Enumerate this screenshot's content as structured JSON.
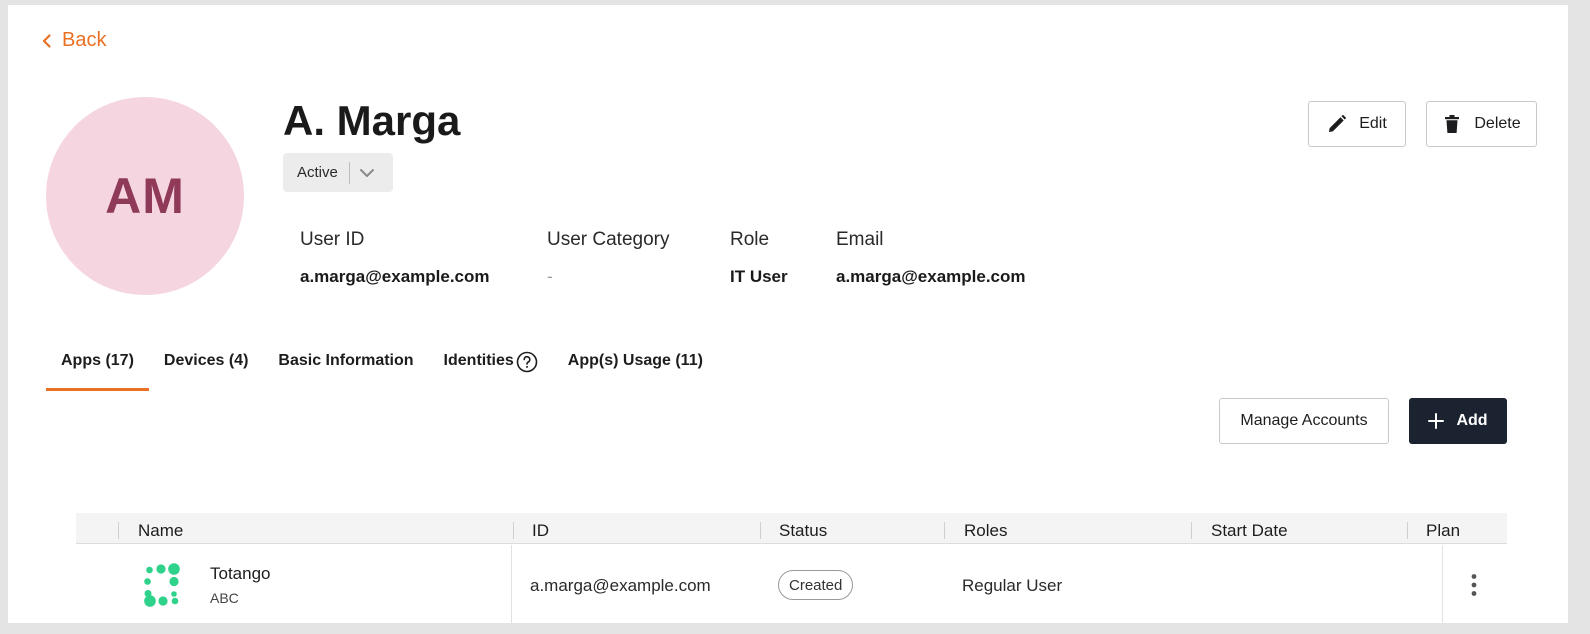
{
  "nav": {
    "back_label": "Back"
  },
  "user": {
    "initials": "AM",
    "name": "A. Marga",
    "status": "Active",
    "avatar_color": "#f5d6e0",
    "initials_color": "#8f3a59"
  },
  "actions": {
    "edit_label": "Edit",
    "delete_label": "Delete"
  },
  "details": [
    {
      "label": "User ID",
      "value": "a.marga@example.com"
    },
    {
      "label": "User Category",
      "value": "-"
    },
    {
      "label": "Role",
      "value": "IT User"
    },
    {
      "label": "Email",
      "value": "a.marga@example.com"
    }
  ],
  "tabs": [
    {
      "label": "Apps (17)",
      "active": true
    },
    {
      "label": "Devices (4)"
    },
    {
      "label": "Basic Information"
    },
    {
      "label": "Identities",
      "icon": "help-circle-icon"
    },
    {
      "label": "App(s) Usage (11)"
    }
  ],
  "toolbar": {
    "manage_label": "Manage Accounts",
    "add_label": "Add"
  },
  "table": {
    "columns": [
      "Name",
      "ID",
      "Status",
      "Roles",
      "Start Date",
      "Plan"
    ],
    "rows": [
      {
        "name": "Totango",
        "subtitle": "ABC",
        "icon": "totango-logo-icon",
        "id": "a.marga@example.com",
        "status": "Created",
        "roles": "Regular User",
        "start_date": "",
        "plan": ""
      }
    ]
  },
  "colors": {
    "accent": "#ea7024",
    "primary_button": "#1b2230",
    "logo_green": "#2fd28a"
  }
}
